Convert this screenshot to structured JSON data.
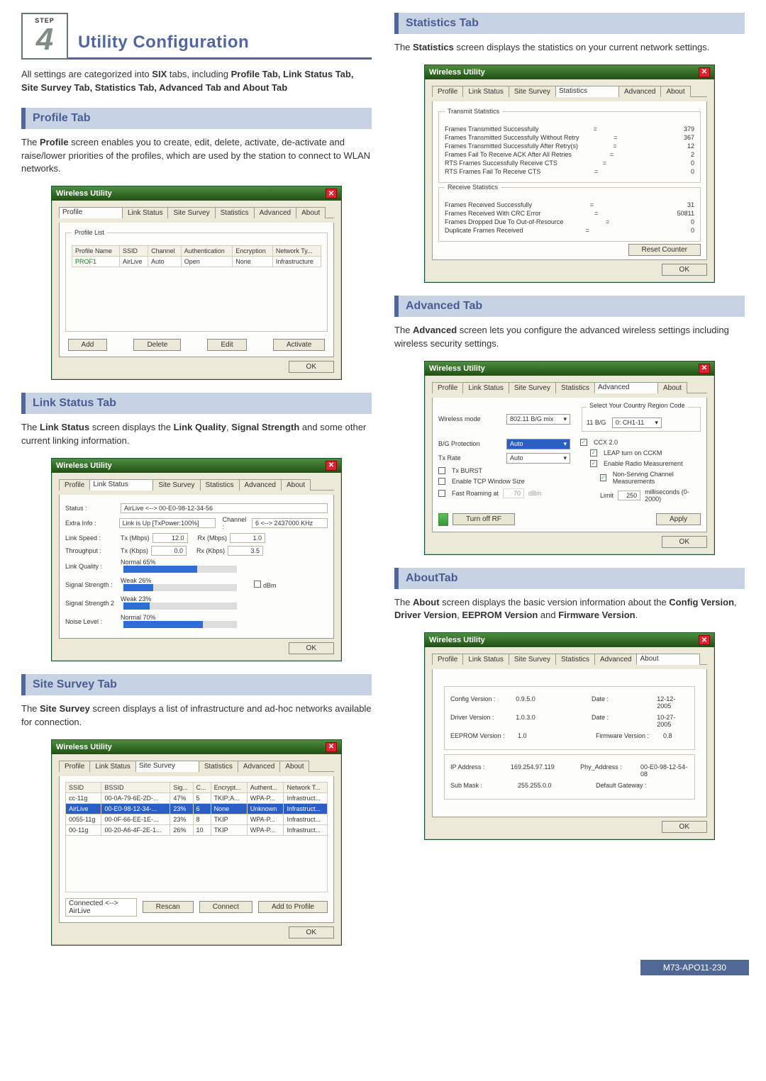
{
  "step": {
    "label": "STEP",
    "num": "4",
    "title": "Utility Configuration"
  },
  "intro": "All settings are categorized into SIX tabs, including Profile Tab, Link Status Tab, Site Survey Tab, Statistics Tab, Advanced Tab and About Tab",
  "dialog_title": "Wireless Utility",
  "ok": "OK",
  "tabs": {
    "profile": "Profile",
    "link": "Link Status",
    "site": "Site Survey",
    "stats": "Statistics",
    "adv": "Advanced",
    "about": "About"
  },
  "profile": {
    "head": "Profile Tab",
    "text": "The Profile screen  enables you to create, edit, delete, activate, de-activate and raise/lower priorities of the profiles,  which are used by the station to connect to WLAN networks.",
    "list_label": "Profile List",
    "cols": [
      "Profile Name",
      "SSID",
      "Channel",
      "Authentication",
      "Encryption",
      "Network Ty..."
    ],
    "row": [
      "PROF1",
      "AirLive",
      "Auto",
      "Open",
      "None",
      "Infrastructure"
    ],
    "btns": {
      "add": "Add",
      "del": "Delete",
      "edit": "Edit",
      "act": "Activate"
    }
  },
  "link": {
    "head": "Link Status Tab",
    "text": "The Link Status screen displays the Link Quality, Signal Strength and some other current linking information.",
    "status_l": "Status :",
    "status_v": "AirLive <--> 00-E0-98-12-34-56",
    "extra_l": "Extra Info :",
    "extra_v": "Link is Up [TxPower:100%]",
    "chan_l": "Channel :",
    "chan_v": "6 <--> 2437000 KHz",
    "speed_l": "Link Speed :",
    "tx_l": "Tx (Mbps)",
    "tx_v": "12.0",
    "rx_l": "Rx (Mbps)",
    "rx_v": "1.0",
    "thr_l": "Throughput :",
    "txk_l": "Tx (Kbps)",
    "txk_v": "0.0",
    "rxk_l": "Rx (Kbps)",
    "rxk_v": "3.5",
    "lq_l": "Link Quality :",
    "lq_n": "Normal",
    "lq_p": "65%",
    "ss_l": "Signal Strength :",
    "ss_n": "Weak",
    "ss_p": "26%",
    "dbm": "dBm",
    "ss2_l": "Signal Strength 2",
    "ss2_n": "Weak",
    "ss2_p": "23%",
    "nl_l": "Noise Level :",
    "nl_n": "Normal",
    "nl_p": "70%"
  },
  "site": {
    "head": "Site Survey Tab",
    "text": "The Site Survey screen displays a list of infrastructure and ad-hoc networks available for connection.",
    "cols": [
      "SSID",
      "BSSID",
      "Sig...",
      "C...",
      "Encrypt...",
      "Authent...",
      "Network T..."
    ],
    "rows": [
      [
        "cc-11g",
        "00-0A-79-6E-2D-...",
        "47%",
        "5",
        "TKIP;A...",
        "WPA-P...",
        "Infrastruct..."
      ],
      [
        "AirLive",
        "00-E0-98-12-34-...",
        "23%",
        "6",
        "None",
        "Unknown",
        "Infrastruct..."
      ],
      [
        "0055-11g",
        "00-0F-66-EE-1E-...",
        "23%",
        "8",
        "TKIP",
        "WPA-P...",
        "Infrastruct..."
      ],
      [
        "00-11g",
        "00-20-A6-4F-2E-1...",
        "26%",
        "10",
        "TKIP",
        "WPA-P...",
        "Infrastruct..."
      ]
    ],
    "sel_row": 1,
    "status": "Connected <--> AirLive",
    "btns": {
      "rescan": "Rescan",
      "connect": "Connect",
      "add": "Add to Profile"
    }
  },
  "stats": {
    "head": "Statistics Tab",
    "text": "The Statistics screen displays the statistics on your current network settings.",
    "tx_legend": "Transmit Statistics",
    "tx": [
      [
        "Frames Transmitted Successfully",
        "379"
      ],
      [
        "Frames Transmitted Successfully  Without Retry",
        "367"
      ],
      [
        "Frames Transmitted Successfully After Retry(s)",
        "12"
      ],
      [
        "Frames Fail To Receive ACK After All Retries",
        "2"
      ],
      [
        "RTS Frames Successfully Receive CTS",
        "0"
      ],
      [
        "RTS Frames Fail To Receive CTS",
        "0"
      ]
    ],
    "rx_legend": "Receive Statistics",
    "rx": [
      [
        "Frames Received Successfully",
        "31"
      ],
      [
        "Frames Received With CRC Error",
        "50811"
      ],
      [
        "Frames Dropped Due To Out-of-Resource",
        "0"
      ],
      [
        "Duplicate Frames Received",
        "0"
      ]
    ],
    "reset": "Reset Counter"
  },
  "adv": {
    "head": "Advanced Tab",
    "text": "The Advanced screen  lets you configure the advanced wireless settings including wireless security settings.",
    "wmode_l": "Wireless mode",
    "wmode_v": "802.11 B/G mix",
    "country_l": "Select Your Country Region Code",
    "bg_l": "11 B/G",
    "bg_v": "0: CH1-11",
    "bgp_l": "B/G Protection",
    "bgp_v": "Auto",
    "txrate_l": "Tx Rate",
    "txrate_v": "Auto",
    "txburst": "Tx BURST",
    "tcp": "Enable TCP Window Size",
    "fast": "Fast Roaming at",
    "fast_v": "70",
    "fast_u": "dBm",
    "ccx": "CCX 2.0",
    "leap": "LEAP turn on CCKM",
    "radio": "Enable Radio Measurement",
    "nons": "Non-Serving Channel Measurements",
    "limit_l": "Limit",
    "limit_v": "250",
    "limit_u": "milliseconds (0-2000)",
    "turnoff": "Turn off RF",
    "apply": "Apply"
  },
  "about": {
    "head": "AboutTab",
    "text": "The About screen  displays the basic version information about the Config Version, Driver Version, EEPROM Version and Firmware Version.",
    "cfg_l": "Config Version :",
    "cfg_v": "0.9.5.0",
    "cfg_dl": "Date :",
    "cfg_d": "12-12-2005",
    "drv_l": "Driver Version :",
    "drv_v": "1.0.3.0",
    "drv_dl": "Date :",
    "drv_d": "10-27-2005",
    "ee_l": "EEPROM Version :",
    "ee_v": "1.0",
    "fw_l": "Firmware Version :",
    "fw_v": "0.8",
    "ip_l": "IP Address :",
    "ip_v": "169.254.97.119",
    "phy_l": "Phy_Address :",
    "phy_v": "00-E0-98-12-54-08",
    "sub_l": "Sub Mask :",
    "sub_v": "255.255.0.0",
    "gw_l": "Default Gateway :",
    "gw_v": ""
  },
  "footer": "M73-APO11-230"
}
